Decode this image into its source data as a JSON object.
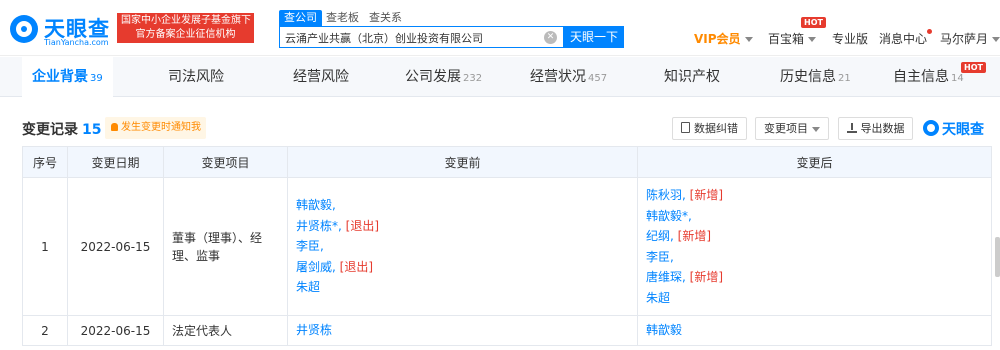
{
  "header": {
    "logo": {
      "name": "天眼查",
      "domain": "TianYancha.com"
    },
    "gov_badge": {
      "line1": "国家中小企业发展子基金旗下",
      "line2": "官方备案企业征信机构"
    },
    "search_tabs": [
      "查公司",
      "查老板",
      "查关系"
    ],
    "search_value": "云涌产业共赢（北京）创业投资有限公司",
    "search_button": "天眼一下",
    "vip_label": "VIP会员",
    "baibaoxiang": "百宝箱",
    "hot": "HOT",
    "pro": "专业版",
    "messages": "消息中心",
    "user": "马尔萨月"
  },
  "tabs": [
    {
      "label": "企业背景",
      "count": "39"
    },
    {
      "label": "司法风险",
      "count": ""
    },
    {
      "label": "经营风险",
      "count": ""
    },
    {
      "label": "公司发展",
      "count": "232"
    },
    {
      "label": "经营状况",
      "count": "457"
    },
    {
      "label": "知识产权",
      "count": ""
    },
    {
      "label": "历史信息",
      "count": "21"
    },
    {
      "label": "自主信息",
      "count": "14"
    }
  ],
  "section": {
    "title": "变更记录",
    "count": "15",
    "notify": "发生变更时通知我",
    "correction": "数据纠错",
    "change_item": "变更项目",
    "export": "导出数据",
    "watermark": "天眼查"
  },
  "table": {
    "headers": [
      "序号",
      "变更日期",
      "变更项目",
      "变更前",
      "变更后"
    ],
    "rows": [
      {
        "no": "1",
        "date": "2022-06-15",
        "item": "董事（理事）、经理、监事",
        "before": [
          {
            "name": "韩歆毅,",
            "tag": ""
          },
          {
            "name": "井贤栋*,",
            "tag": "[退出]"
          },
          {
            "name": "李臣,",
            "tag": ""
          },
          {
            "name": "屠剑威,",
            "tag": "[退出]"
          },
          {
            "name": "朱超",
            "tag": ""
          }
        ],
        "after": [
          {
            "name": "陈秋羽,",
            "tag": "[新增]"
          },
          {
            "name": "韩歆毅*,",
            "tag": ""
          },
          {
            "name": "纪纲,",
            "tag": "[新增]"
          },
          {
            "name": "李臣,",
            "tag": ""
          },
          {
            "name": "唐维琛,",
            "tag": "[新增]"
          },
          {
            "name": "朱超",
            "tag": ""
          }
        ]
      },
      {
        "no": "2",
        "date": "2022-06-15",
        "item": "法定代表人",
        "before": [
          {
            "name": "井贤栋",
            "tag": ""
          }
        ],
        "after": [
          {
            "name": "韩歆毅",
            "tag": ""
          }
        ]
      }
    ]
  },
  "colors": {
    "brand": "#0084ff",
    "red": "#e63b2e",
    "vip": "#ff8a00"
  }
}
